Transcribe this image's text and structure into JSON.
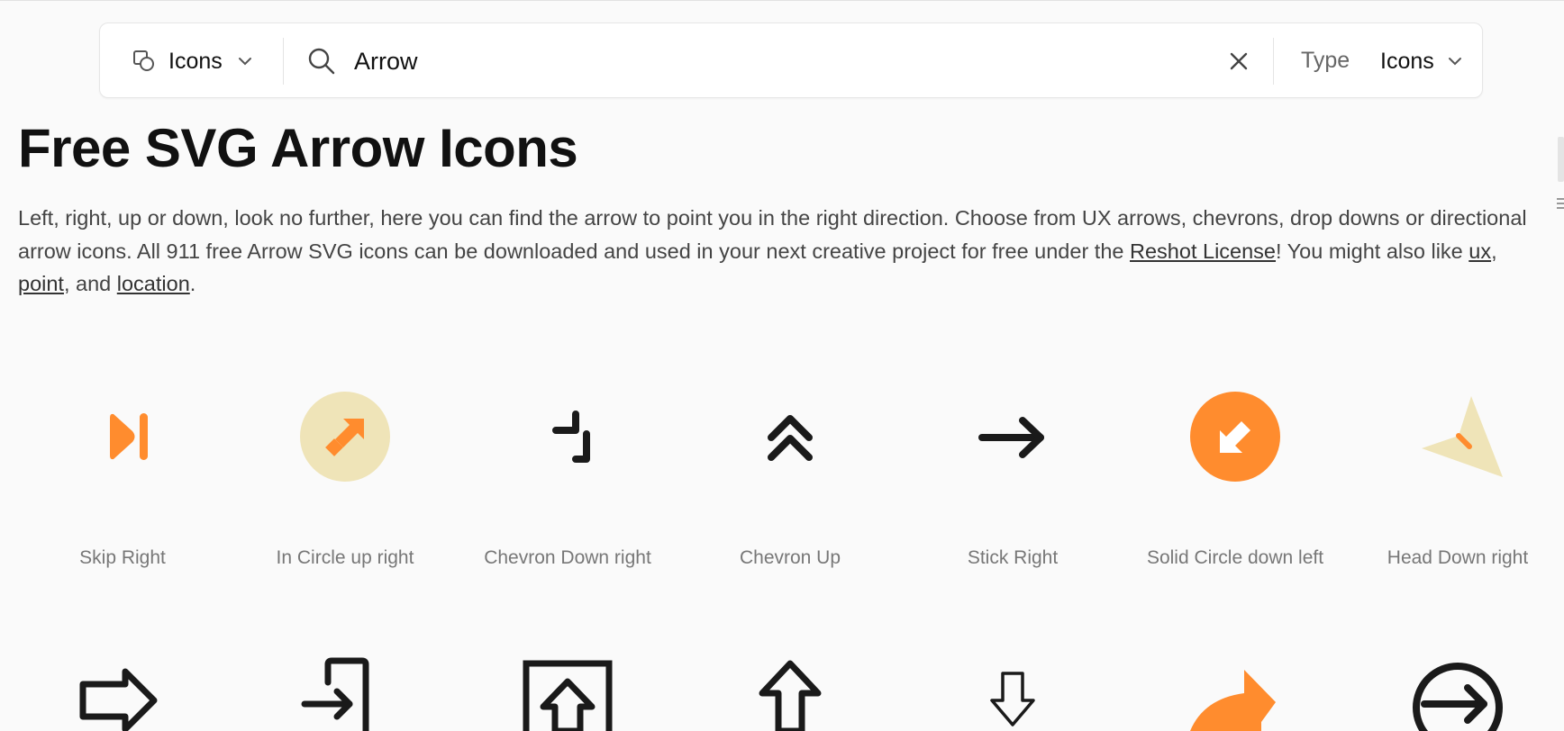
{
  "search": {
    "category": "Icons",
    "query": "Arrow",
    "placeholder": "Search",
    "type_label": "Type",
    "type_value": "Icons"
  },
  "page": {
    "title": "Free SVG Arrow Icons",
    "description_1": "Left, right, up or down, look no further, here you can find the arrow to point you in the right direction. Choose from UX arrows, chevrons, drop downs or directional arrow icons. All 911 free Arrow SVG icons can be downloaded and used in your next creative project for free under the ",
    "license_link": "Reshot License",
    "description_2": "! You might also like ",
    "link_ux": "ux",
    "sep_1": ", ",
    "link_point": "point",
    "sep_2": ", and ",
    "link_location": "location",
    "end": "."
  },
  "colors": {
    "accent_orange": "#FF8C2E",
    "accent_beige": "#EFE4B8",
    "ink": "#1a1a1a"
  },
  "icons_row1": [
    {
      "name": "Skip Right",
      "icon": "skip-right-icon"
    },
    {
      "name": "In Circle up right",
      "icon": "in-circle-up-right-icon"
    },
    {
      "name": "Chevron Down right",
      "icon": "chevron-down-right-icon"
    },
    {
      "name": "Chevron Up",
      "icon": "chevron-up-icon"
    },
    {
      "name": "Stick Right",
      "icon": "stick-right-icon"
    },
    {
      "name": "Solid Circle down left",
      "icon": "solid-circle-down-left-icon"
    },
    {
      "name": "Head Down right",
      "icon": "head-down-right-icon"
    }
  ],
  "icons_row2": [
    {
      "icon": "outline-arrow-right-icon"
    },
    {
      "icon": "login-icon"
    },
    {
      "icon": "upload-box-icon"
    },
    {
      "icon": "outline-arrow-up-icon"
    },
    {
      "icon": "outline-arrow-down-icon"
    },
    {
      "icon": "share-curve-icon"
    },
    {
      "icon": "circle-arrow-right-icon"
    }
  ]
}
